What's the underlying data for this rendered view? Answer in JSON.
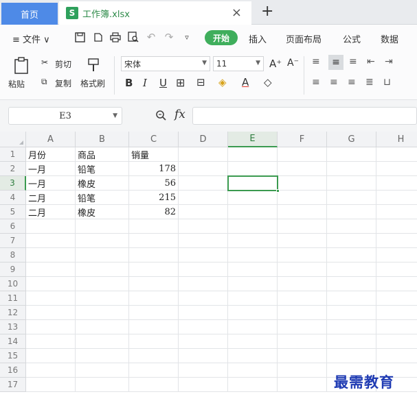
{
  "tabs": {
    "home_label": "首页",
    "file_icon_letter": "S",
    "file_name": "工作簿.xlsx",
    "close_symbol": "×",
    "new_tab_symbol": "+"
  },
  "menu": {
    "file_label": "≡ 文件 ∨",
    "start": "开始",
    "items": [
      "插入",
      "页面布局",
      "公式",
      "数据"
    ]
  },
  "ribbon": {
    "paste": "粘贴",
    "cut": "剪切",
    "copy": "复制",
    "format_painter": "格式刷",
    "font_name": "宋体",
    "font_size": "11",
    "bold": "B",
    "italic": "I",
    "underline": "U",
    "grow_font": "A⁺",
    "shrink_font": "A⁻",
    "font_color": "A"
  },
  "formula_bar": {
    "name_box": "E3",
    "fx": "fx",
    "formula": ""
  },
  "sheet": {
    "columns": [
      "A",
      "B",
      "C",
      "D",
      "E",
      "F",
      "G",
      "H"
    ],
    "active_column": "E",
    "active_row": 3,
    "rows": [
      1,
      2,
      3,
      4,
      5,
      6,
      7,
      8,
      9,
      10,
      11,
      12,
      13,
      14,
      15,
      16,
      17
    ],
    "data": [
      [
        "月份",
        "商品",
        "销量"
      ],
      [
        "一月",
        "铅笔",
        "178"
      ],
      [
        "一月",
        "橡皮",
        "56"
      ],
      [
        "二月",
        "铅笔",
        "215"
      ],
      [
        "二月",
        "橡皮",
        "82"
      ]
    ]
  },
  "watermark": "最需教育",
  "colors": {
    "accent_green": "#3a9a4f",
    "home_tab_blue": "#4e8ae7",
    "start_button_green": "#3fae5c"
  }
}
